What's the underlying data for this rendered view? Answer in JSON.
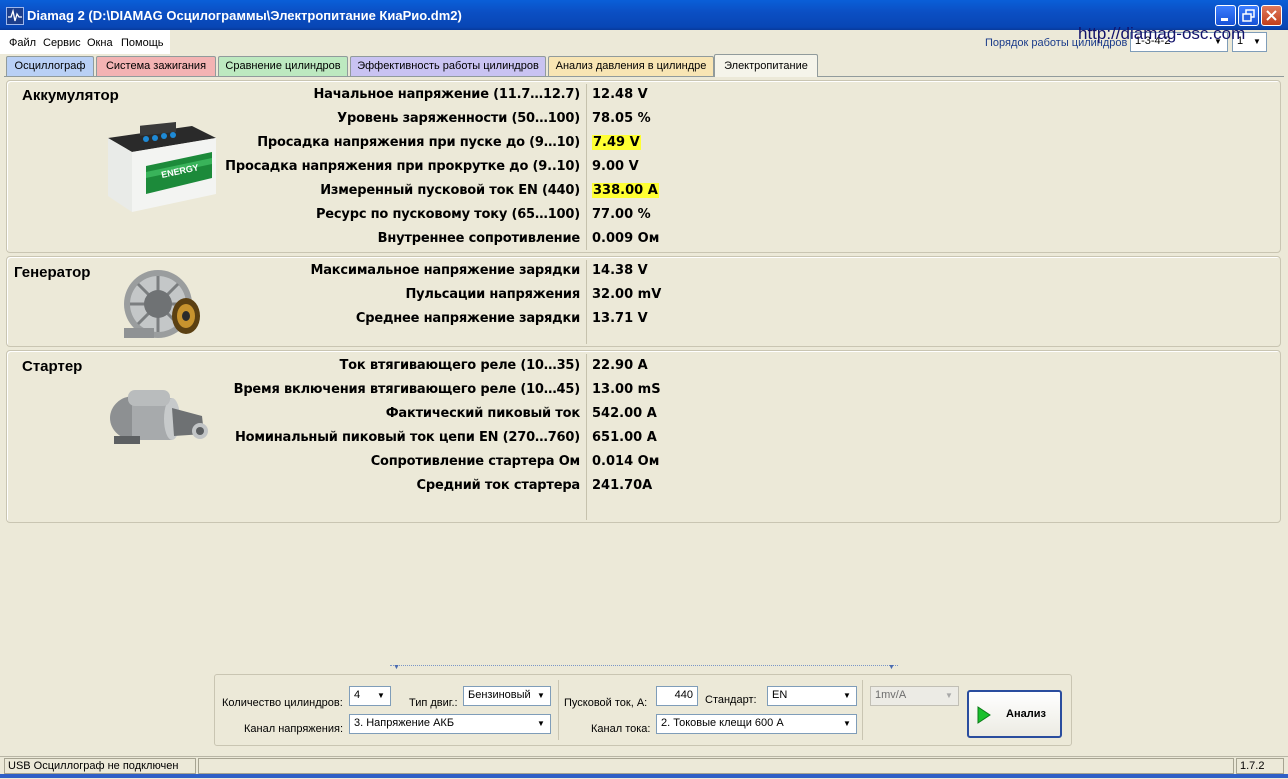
{
  "window": {
    "title": "Diamag 2 (D:\\DIAMAG Осцилограммы\\Электропитание КиаРио.dm2)",
    "minimize_icon": "minimize-icon",
    "maximize_icon": "restore-icon",
    "close_icon": "close-icon"
  },
  "menu": [
    "Файл",
    "Сервис",
    "Окна",
    "Помощь"
  ],
  "header": {
    "order_label": "Порядок работы цилиндров",
    "order_value": "1-3-4-2",
    "order_start": "1",
    "site": "http://diamag-osc.com"
  },
  "tabs": [
    {
      "label": "Осциллограф",
      "color": "#b9d0f5"
    },
    {
      "label": "Система зажигания",
      "color": "#f3b3b3"
    },
    {
      "label": "Сравнение цилиндров",
      "color": "#bde9c0"
    },
    {
      "label": "Эффективность работы цилиндров",
      "color": "#c9c3f2"
    },
    {
      "label": "Анализ давления в цилиндре",
      "color": "#f8e5b4"
    },
    {
      "label": "Электропитание",
      "color": "#f5f4ea",
      "active": true
    }
  ],
  "battery": {
    "title": "Аккумулятор",
    "image_label": "ENERGY",
    "rows": [
      {
        "label": "Начальное напряжение (11.7…12.7)",
        "value": "12.48 V"
      },
      {
        "label": "Уровень заряженности (50…100)",
        "value": "78.05 %"
      },
      {
        "label": "Просадка напряжения при пуске до (9…10)",
        "value": "7.49 V",
        "highlight": true
      },
      {
        "label": "Просадка напряжения при прокрутке до  (9..10)",
        "value": "9.00 V"
      },
      {
        "label": "Измеренный пусковой ток  EN (440)",
        "value": "338.00 A",
        "highlight": true
      },
      {
        "label": "Ресурс по пусковому току (65…100)",
        "value": "77.00 %"
      },
      {
        "label": "Внутреннее сопротивление",
        "value": "0.009 Ом"
      }
    ]
  },
  "generator": {
    "title": "Генератор",
    "rows": [
      {
        "label": "Максимальное напряжение зарядки",
        "value": "14.38 V"
      },
      {
        "label": "Пульсации напряжения",
        "value": "32.00 mV"
      },
      {
        "label": "Среднее напряжение зарядки",
        "value": "13.71 V"
      }
    ]
  },
  "starter": {
    "title": "Стартер",
    "rows": [
      {
        "label": "Ток втягивающего реле (10…35)",
        "value": "22.90 A"
      },
      {
        "label": "Время включения втягивающего реле (10…45)",
        "value": "13.00 mS"
      },
      {
        "label": "Фактический пиковый ток",
        "value": "542.00 A"
      },
      {
        "label": "Номинальный пиковый ток цепи EN (270…760)",
        "value": "651.00 A"
      },
      {
        "label": "Сопротивление стартера Ом",
        "value": "0.014 Ом"
      },
      {
        "label": "Средний ток стартера",
        "value": "241.70A"
      }
    ]
  },
  "controls": {
    "cyl_count_label": "Количество цилиндров:",
    "cyl_count_value": "4",
    "engine_type_label": "Тип двиг.:",
    "engine_type_value": "Бензиновый",
    "voltage_channel_label": "Канал напряжения:",
    "voltage_channel_value": "3.  Напряжение АКБ",
    "start_current_label": "Пусковой ток, А:",
    "start_current_value": "440",
    "standard_label": "Стандарт:",
    "standard_value": "EN",
    "current_channel_label": "Канал тока:",
    "current_channel_value": "2.  Токовые клещи 600 А",
    "sensitivity_value": "1mv/A",
    "analyze_label": "Анализ"
  },
  "status": {
    "connection": "USB Осциллограф не подключен",
    "version": "1.7.2"
  }
}
